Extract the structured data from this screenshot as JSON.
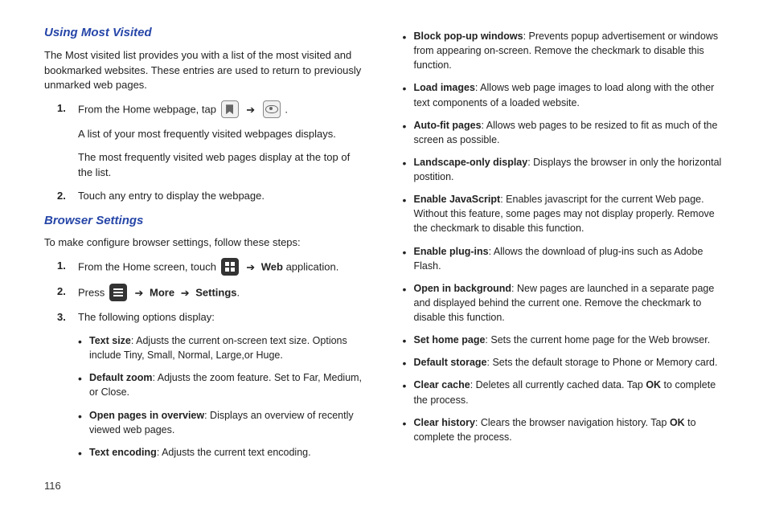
{
  "pageNumber": "116",
  "col1": {
    "h1": "Using Most Visited",
    "intro": "The Most visited list provides you with a list of the most visited and bookmarked websites. These entries are used to return to previously unmarked web pages.",
    "step1_a": "From the Home webpage, tap ",
    "step1_b": ".",
    "step1_p2": "A list of your most frequently visited webpages displays.",
    "step1_p3": "The most frequently visited web pages display at the top of the list.",
    "step2": "Touch any entry to display the webpage.",
    "h2": "Browser Settings",
    "h2_intro": "To make configure browser settings, follow these steps:",
    "b_step1_a": "From the Home screen, touch ",
    "b_step1_b": " application.",
    "b_step1_web": "Web",
    "b_step2_a": "Press ",
    "b_step2_more": "More",
    "b_step2_settings": "Settings",
    "b_step3": "The following options display:",
    "bullets": [
      {
        "term": "Text size",
        "desc": ": Adjusts the current on-screen text size. Options include Tiny, Small, Normal, Large,or Huge."
      },
      {
        "term": "Default zoom",
        "desc": ": Adjusts the zoom feature. Set to Far, Medium, or Close."
      },
      {
        "term": "Open pages in overview",
        "desc": ": Displays an overview of recently viewed web pages."
      },
      {
        "term": "Text encoding",
        "desc": ": Adjusts the current text encoding."
      }
    ]
  },
  "col2": {
    "bullets": [
      {
        "term": "Block pop-up windows",
        "desc": ": Prevents popup advertisement or windows from appearing on-screen. Remove the checkmark to disable this function."
      },
      {
        "term": "Load images",
        "desc": ": Allows web page images to load along with the other text components of a loaded website."
      },
      {
        "term": "Auto-fit pages",
        "desc": ": Allows web pages to be resized to fit as much of the screen as possible."
      },
      {
        "term": "Landscape-only display",
        "desc": ": Displays the browser in only the horizontal postition."
      },
      {
        "term": "Enable JavaScript",
        "desc": ": Enables javascript for the current Web page. Without this feature, some pages may not display properly. Remove the checkmark to disable this function."
      },
      {
        "term": "Enable plug-ins",
        "desc": ": Allows the download of plug-ins such as Adobe Flash."
      },
      {
        "term": "Open in background",
        "desc": ": New pages are launched in a separate page and displayed behind the current one. Remove the checkmark to disable this function."
      },
      {
        "term": "Set home page",
        "desc": ": Sets the current home page for the Web browser."
      },
      {
        "term": "Default storage",
        "desc": ": Sets the default storage to Phone or Memory card."
      },
      {
        "term": "Clear cache",
        "desc_a": ": Deletes all currently cached data. Tap ",
        "ok": "OK",
        "desc_b": " to complete the process."
      },
      {
        "term": "Clear history",
        "desc_a": ": Clears the browser navigation history. Tap ",
        "ok": "OK",
        "desc_b": " to complete the process."
      }
    ]
  }
}
